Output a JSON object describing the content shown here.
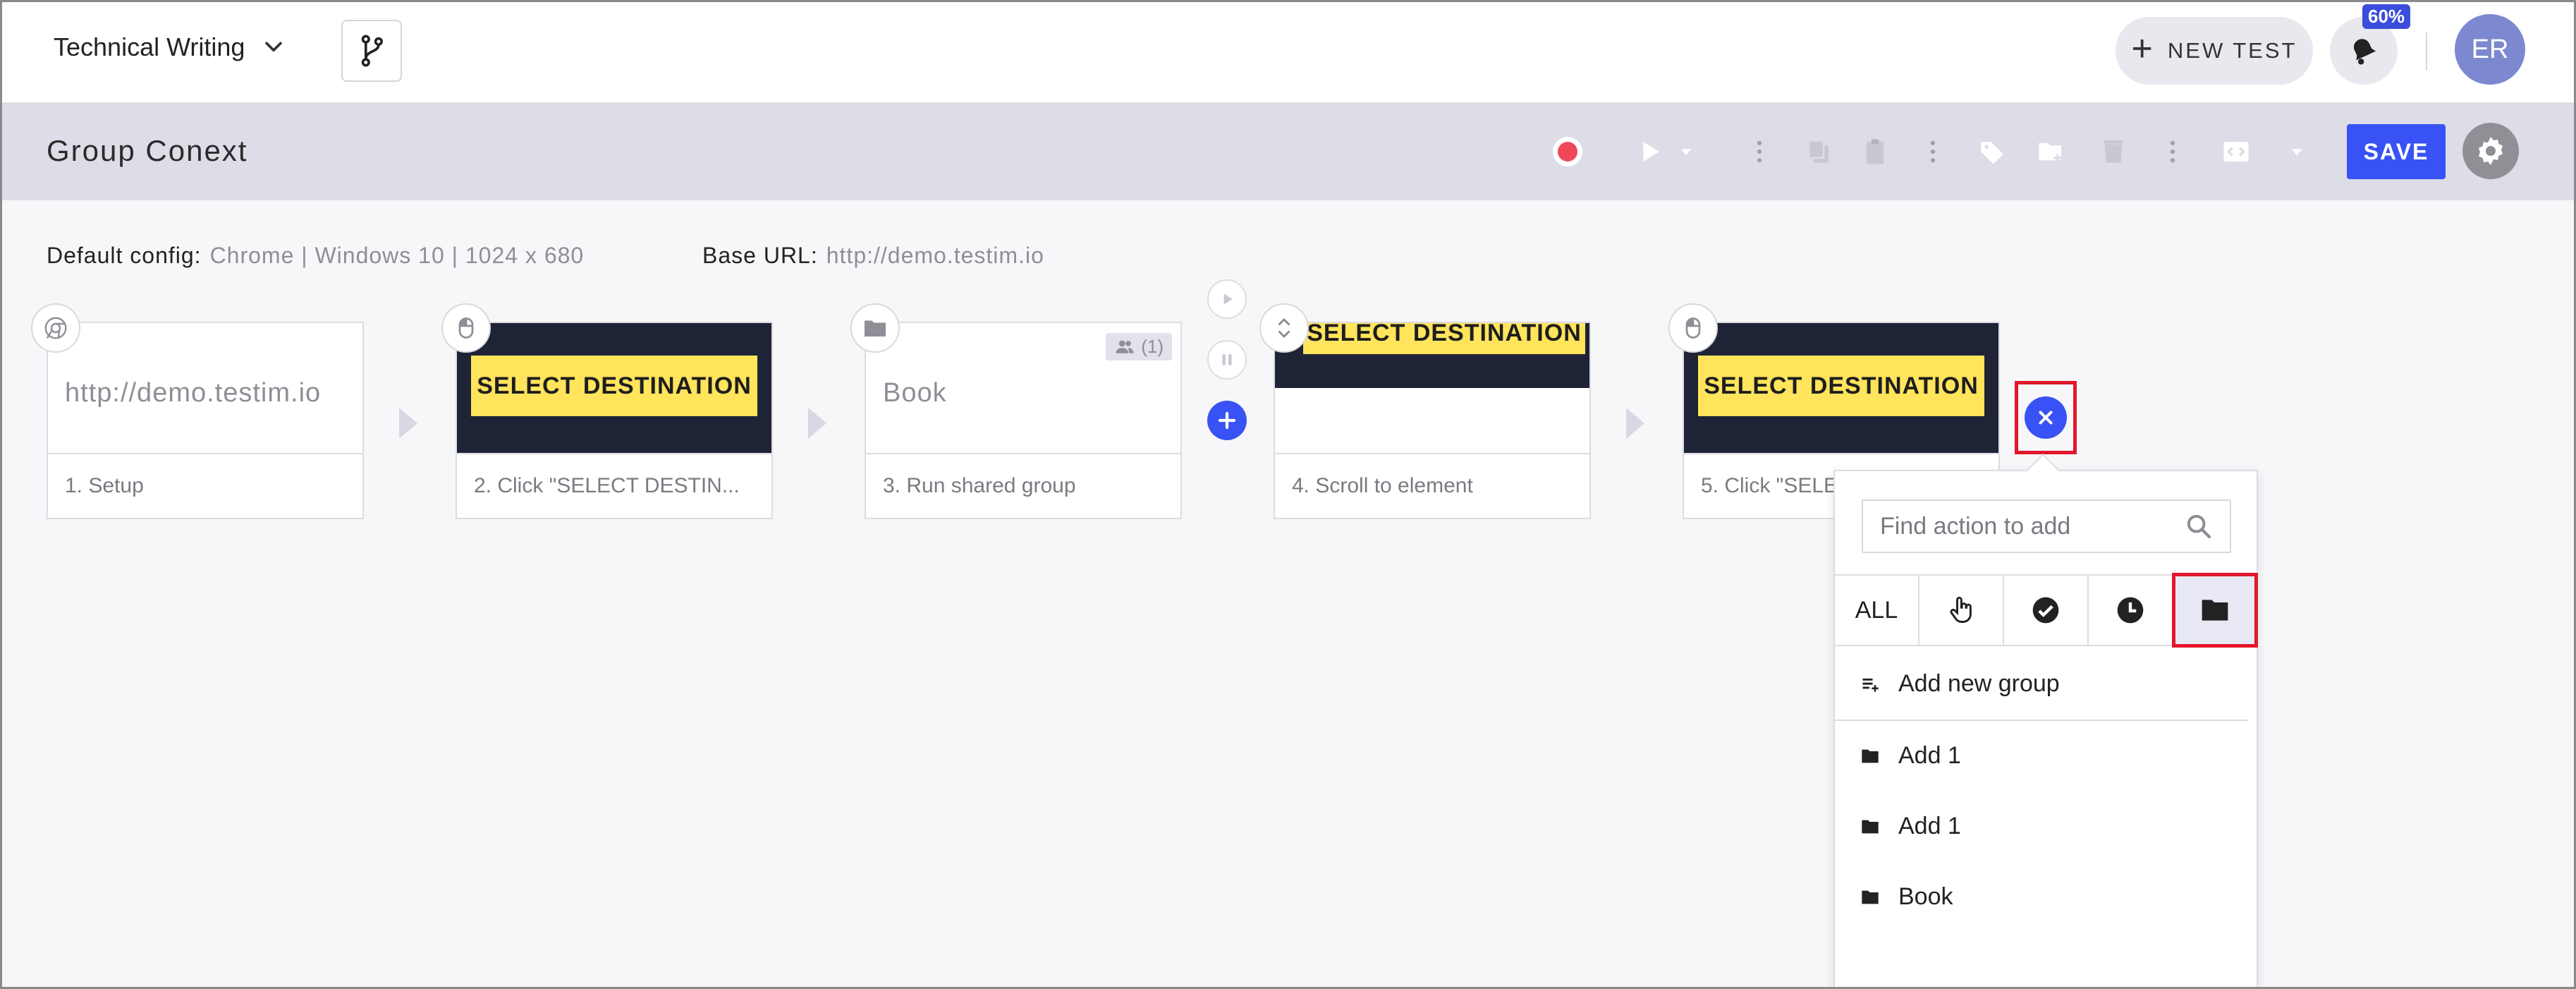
{
  "header": {
    "project_name": "Technical Writing",
    "new_test_label": "NEW TEST",
    "notification_badge": "60%",
    "avatar_initials": "ER"
  },
  "toolbar": {
    "test_title": "Group Conext",
    "save_label": "SAVE"
  },
  "info": {
    "default_config_label": "Default config:",
    "default_config_value": "Chrome | Windows 10 | 1024 x 680",
    "base_url_label": "Base URL:",
    "base_url_value": "http://demo.testim.io"
  },
  "steps": [
    {
      "thumb_text": "http://demo.testim.io",
      "label": "1. Setup",
      "icon": "chrome-icon"
    },
    {
      "thumb_text": "SELECT DESTINATION",
      "label": "2. Click \"SELECT DESTIN...",
      "icon": "mouse-icon"
    },
    {
      "thumb_text": "Book",
      "label": "3. Run shared group",
      "icon": "folder-icon",
      "badge": "(1)"
    },
    {
      "thumb_text": "SELECT DESTINATION",
      "label": "4. Scroll to element",
      "icon": "scroll-icon"
    },
    {
      "thumb_text": "SELECT DESTINATION",
      "label": "5. Click \"SELE",
      "icon": "mouse-icon"
    }
  ],
  "dropdown": {
    "search_placeholder": "Find action to add",
    "filters": [
      "ALL",
      "hand-pointer-icon",
      "check-circle-icon",
      "clock-icon",
      "folder-icon"
    ],
    "active_filter": "folder-icon",
    "add_group_label": "Add new group",
    "groups": [
      "Add 1",
      "Add 1",
      "Book"
    ]
  },
  "colors": {
    "accent": "#3852f5",
    "highlight": "#e3172b",
    "record": "#f0485a",
    "thumb_yellow": "#ffe45c"
  }
}
